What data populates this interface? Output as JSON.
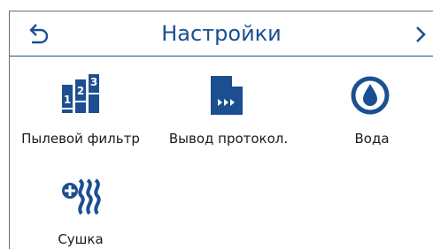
{
  "header": {
    "title": "Настройки",
    "back_icon": "back-arrow-icon",
    "next_icon": "chevron-right-icon"
  },
  "tiles": [
    {
      "label": "Пылевой фильтр",
      "icon": "dust-filter-icon"
    },
    {
      "label": "Вывод протокол.",
      "icon": "protocol-output-icon"
    },
    {
      "label": "Вода",
      "icon": "water-drop-icon"
    },
    {
      "label": "Сушка",
      "icon": "drying-icon"
    }
  ],
  "colors": {
    "accent": "#1c4f91",
    "text": "#1b1b1b",
    "border": "#6d6d6d"
  }
}
